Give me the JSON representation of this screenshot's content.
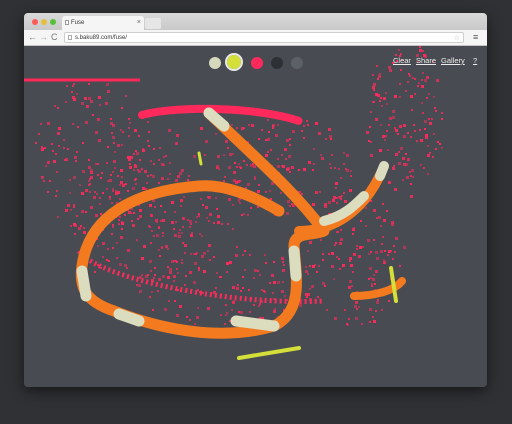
{
  "browser": {
    "tab_title": "Fuse",
    "tab_close": "×",
    "url": "s.baku89.com/fuse/",
    "back": "←",
    "forward": "→",
    "reload": "C",
    "star": "☆",
    "menu": "≡"
  },
  "palette": [
    {
      "name": "cream",
      "color": "#d7d9bd"
    },
    {
      "name": "yellow",
      "color": "#d4df3a",
      "selected": true
    },
    {
      "name": "pink",
      "color": "#ff2a5b"
    },
    {
      "name": "dark",
      "color": "#2d3035"
    },
    {
      "name": "gray",
      "color": "#5c6067"
    }
  ],
  "menu": {
    "clear": "Clear",
    "share": "Share",
    "gallery": "Gallery",
    "help": "?"
  },
  "colors": {
    "canvas_bg": "#484c52",
    "orange": "#f47a1f",
    "cream": "#dcdcbf",
    "pink": "#ff2a5b",
    "yellow": "#d4df3a"
  }
}
